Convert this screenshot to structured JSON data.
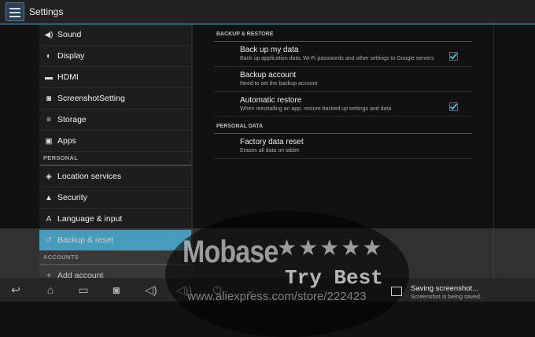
{
  "app": {
    "title": "Settings",
    "icon": "settings-app-icon"
  },
  "sidebar": {
    "items_top": [
      {
        "label": "Sound",
        "icon": "speaker-icon",
        "glyph": "◀)"
      },
      {
        "label": "Display",
        "icon": "brightness-icon",
        "glyph": "◐"
      },
      {
        "label": "HDMI",
        "icon": "hdmi-icon",
        "glyph": "▬"
      },
      {
        "label": "ScreenshotSetting",
        "icon": "camera-icon",
        "glyph": "◙"
      },
      {
        "label": "Storage",
        "icon": "storage-icon",
        "glyph": "≡"
      },
      {
        "label": "Apps",
        "icon": "apps-icon",
        "glyph": "▣"
      }
    ],
    "header_personal": "PERSONAL",
    "items_personal": [
      {
        "label": "Location services",
        "icon": "location-icon",
        "glyph": "◈"
      },
      {
        "label": "Security",
        "icon": "lock-icon",
        "glyph": "▲"
      },
      {
        "label": "Language & input",
        "icon": "language-icon",
        "glyph": "A"
      },
      {
        "label": "Backup & reset",
        "icon": "backup-icon",
        "glyph": "↺",
        "active": true
      }
    ],
    "header_accounts": "ACCOUNTS",
    "items_accounts": [
      {
        "label": "Add account",
        "icon": "add-icon",
        "glyph": "+"
      }
    ]
  },
  "content": {
    "section_backup": "BACKUP & RESTORE",
    "prefs_backup": [
      {
        "title": "Back up my data",
        "summary": "Back up application data, Wi-Fi passwords and other settings to Google servers",
        "checked": true
      },
      {
        "title": "Backup account",
        "summary": "Need to set the backup account",
        "checked": false
      },
      {
        "title": "Automatic restore",
        "summary": "When reinstalling an app, restore backed up settings and data",
        "checked": true
      }
    ],
    "section_personal": "PERSONAL DATA",
    "prefs_personal": [
      {
        "title": "Factory data reset",
        "summary": "Erases all data on tablet"
      }
    ]
  },
  "navbar": {
    "buttons": [
      "back-icon",
      "home-icon",
      "recents-icon",
      "screenshot-icon",
      "volume-down-icon",
      "power-icon",
      "chevron-down-icon"
    ]
  },
  "watermark": {
    "brand": "Mobase",
    "stars": "★★★★★",
    "tagline": "Try Best",
    "url": "www.aliexpress.com/store/222423"
  },
  "notification": {
    "title": "Saving screenshot...",
    "text": "Screenshot is being saved."
  }
}
